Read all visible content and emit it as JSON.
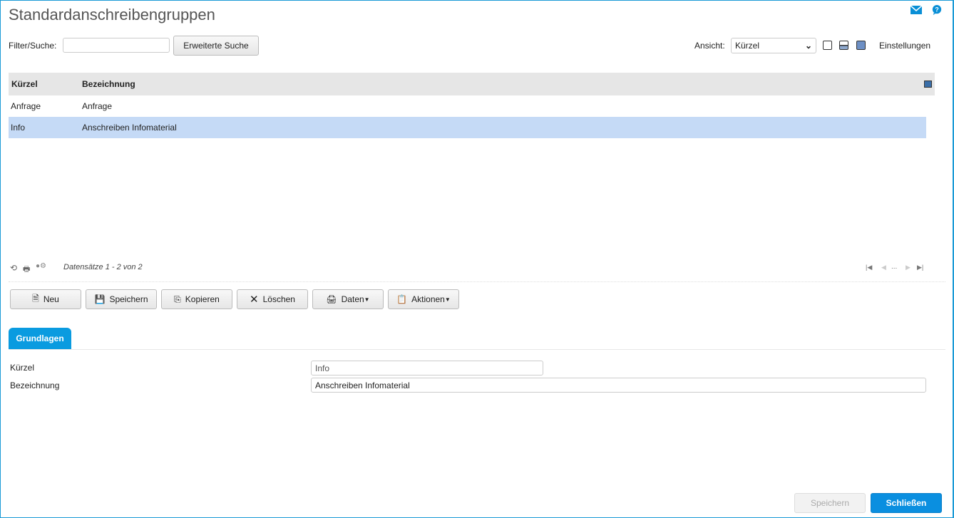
{
  "title": "Standardanschreibengruppen",
  "filter": {
    "label": "Filter/Suche:",
    "value": "",
    "advanced_button": "Erweiterte Suche"
  },
  "view": {
    "label": "Ansicht:",
    "selected": "Kürzel",
    "settings": "Einstellungen"
  },
  "grid": {
    "columns": [
      "Kürzel",
      "Bezeichnung"
    ],
    "rows": [
      {
        "kuerzel": "Anfrage",
        "bezeichnung": "Anfrage"
      },
      {
        "kuerzel": "Info",
        "bezeichnung": "Anschreiben Infomaterial"
      }
    ],
    "records": "Datensätze 1 - 2 von 2",
    "pager_ellipsis": "..."
  },
  "toolbar": {
    "new": "Neu",
    "save": "Speichern",
    "copy": "Kopieren",
    "delete": "Löschen",
    "data": "Daten",
    "actions": "Aktionen"
  },
  "tabs": [
    "Grundlagen"
  ],
  "form": {
    "kuerzel_label": "Kürzel",
    "kuerzel_value": "Info",
    "bezeichnung_label": "Bezeichnung",
    "bezeichnung_value": "Anschreiben Infomaterial"
  },
  "footer": {
    "save": "Speichern",
    "close": "Schließen"
  },
  "colors": {
    "accent": "#0a9be0",
    "selected_row": "#c5daf6"
  }
}
